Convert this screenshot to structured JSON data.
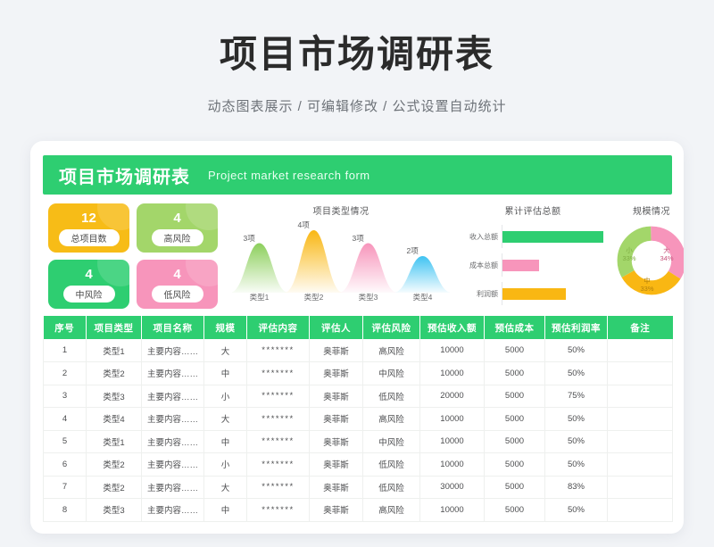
{
  "page": {
    "title": "项目市场调研表",
    "subtitle": "动态图表展示 /  可编辑修改  /  公式设置自动统计"
  },
  "sheet": {
    "header_cn": "项目市场调研表",
    "header_en": "Project market research form",
    "header_color": "#2ece71"
  },
  "kpis": [
    {
      "value": "12",
      "label": "总项目数",
      "color": "#f7bc17"
    },
    {
      "value": "4",
      "label": "高风险",
      "color": "#a3d66a"
    },
    {
      "value": "4",
      "label": "中风险",
      "color": "#2ece71"
    },
    {
      "value": "4",
      "label": "低风险",
      "color": "#f795bb"
    }
  ],
  "chart_data": [
    {
      "type": "area",
      "title": "项目类型情况",
      "categories": [
        "类型1",
        "类型2",
        "类型3",
        "类型4"
      ],
      "values": [
        3,
        4,
        3,
        2
      ],
      "value_labels": [
        "3项",
        "4项",
        "3项",
        "2项"
      ],
      "colors": [
        "#8ccf5c",
        "#f9b713",
        "#f795bb",
        "#3fc3f2"
      ],
      "xlabel": "",
      "ylabel": "",
      "ylim": [
        0,
        5
      ],
      "grid": false,
      "legend": "none"
    },
    {
      "type": "bar",
      "title": "累计评估总额",
      "orientation": "horizontal",
      "categories": [
        "收入总额",
        "成本总额",
        "利润额"
      ],
      "values": [
        110000,
        40000,
        70000
      ],
      "pct_of_max": [
        100,
        36,
        63
      ],
      "colors": [
        "#2ece71",
        "#f795bb",
        "#f9b713"
      ],
      "xlabel": "",
      "ylabel": "",
      "grid": false,
      "legend": "none"
    },
    {
      "type": "pie",
      "title": "规模情况",
      "donut": true,
      "categories": [
        "大",
        "中",
        "小"
      ],
      "values": [
        34,
        33,
        33
      ],
      "value_labels": [
        "34%",
        "33%",
        "33%"
      ],
      "colors": [
        "#f795bb",
        "#f9b713",
        "#a3d66a"
      ],
      "legend": "inside"
    }
  ],
  "table": {
    "columns": [
      "序号",
      "项目类型",
      "项目名称",
      "规模",
      "评估内容",
      "评估人",
      "评估风险",
      "预估收入额",
      "预估成本",
      "预估利润率",
      "备注"
    ],
    "rows": [
      [
        "1",
        "类型1",
        "主要内容……",
        "大",
        "*******",
        "奥菲斯",
        "高风险",
        "10000",
        "5000",
        "50%",
        ""
      ],
      [
        "2",
        "类型2",
        "主要内容……",
        "中",
        "*******",
        "奥菲斯",
        "中风险",
        "10000",
        "5000",
        "50%",
        ""
      ],
      [
        "3",
        "类型3",
        "主要内容……",
        "小",
        "*******",
        "奥菲斯",
        "低风险",
        "20000",
        "5000",
        "75%",
        ""
      ],
      [
        "4",
        "类型4",
        "主要内容……",
        "大",
        "*******",
        "奥菲斯",
        "高风险",
        "10000",
        "5000",
        "50%",
        ""
      ],
      [
        "5",
        "类型1",
        "主要内容……",
        "中",
        "*******",
        "奥菲斯",
        "中风险",
        "10000",
        "5000",
        "50%",
        ""
      ],
      [
        "6",
        "类型2",
        "主要内容……",
        "小",
        "*******",
        "奥菲斯",
        "低风险",
        "10000",
        "5000",
        "50%",
        ""
      ],
      [
        "7",
        "类型2",
        "主要内容……",
        "大",
        "*******",
        "奥菲斯",
        "低风险",
        "30000",
        "5000",
        "83%",
        ""
      ],
      [
        "8",
        "类型3",
        "主要内容……",
        "中",
        "*******",
        "奥菲斯",
        "高风险",
        "10000",
        "5000",
        "50%",
        ""
      ]
    ]
  }
}
